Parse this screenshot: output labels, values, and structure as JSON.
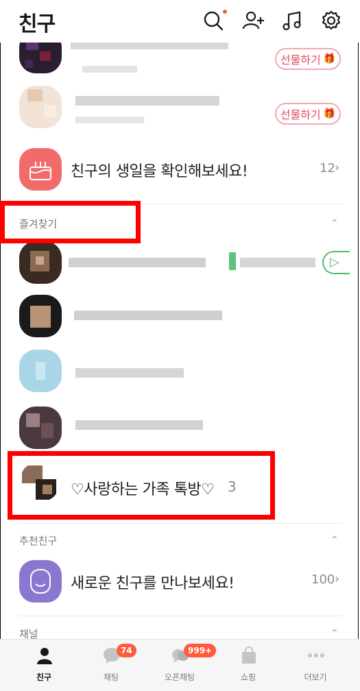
{
  "header": {
    "title": "친구"
  },
  "birthday": {
    "label": "친구의 생일을 확인해보세요!",
    "count": "12"
  },
  "gift_button_label": "선물하기",
  "favorites": {
    "title": "즐겨찾기",
    "chat_room_name": "♡사랑하는 가족 톡방♡",
    "chat_room_count": "3"
  },
  "recommended": {
    "title": "추천친구",
    "label": "새로운 친구를 만나보세요!",
    "count": "100"
  },
  "channel": {
    "title": "채널"
  },
  "tabs": [
    {
      "label": "친구",
      "badge": ""
    },
    {
      "label": "채팅",
      "badge": "74"
    },
    {
      "label": "오픈채팅",
      "badge": "999+"
    },
    {
      "label": "쇼핑",
      "badge": ""
    },
    {
      "label": "더보기",
      "badge": ""
    }
  ],
  "colors": {
    "accent_red": "#ff5a3c",
    "birthday_icon": "#f26b6b",
    "suggest_icon": "#8c77d0",
    "play_green": "#4bbd6a",
    "highlight_box": "#ff0000"
  },
  "icons": [
    "search-icon",
    "add-friend-icon",
    "music-icon",
    "settings-icon",
    "cake-icon",
    "gift-icon",
    "play-icon",
    "smile-icon",
    "person-icon",
    "chat-icon",
    "open-chat-icon",
    "shopping-bag-icon",
    "more-icon"
  ]
}
